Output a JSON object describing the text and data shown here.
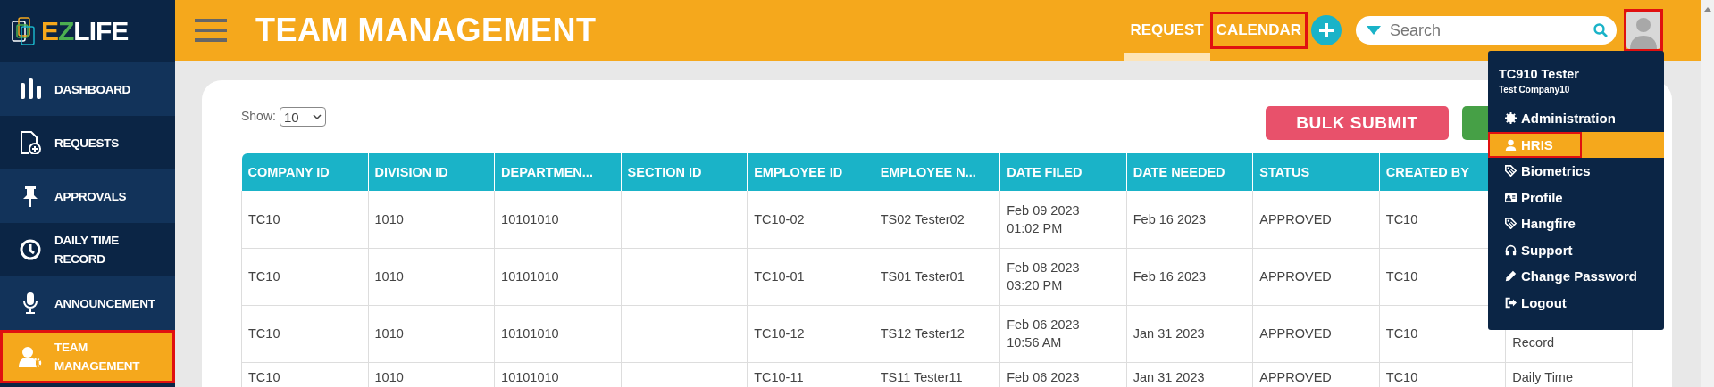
{
  "sidebar": {
    "logo": [
      {
        "text": "E",
        "color": "#f5a81c"
      },
      {
        "text": "Z",
        "color": "#4caf50"
      },
      {
        "text": "LIFE",
        "color": "#ffffff"
      }
    ],
    "items": [
      {
        "label": "DASHBOARD",
        "selected": false,
        "highlighted": false
      },
      {
        "label": "REQUESTS",
        "selected": false,
        "highlighted": false
      },
      {
        "label": "APPROVALS",
        "selected": false,
        "highlighted": false
      },
      {
        "label": "DAILY TIME RECORD",
        "selected": false,
        "highlighted": false
      },
      {
        "label": "ANNOUNCEMENT",
        "selected": false,
        "highlighted": false
      },
      {
        "label": "TEAM MANAGEMENT",
        "selected": true,
        "highlighted": true
      }
    ]
  },
  "header": {
    "title": "TEAM MANAGEMENT",
    "tabs": [
      {
        "label": "REQUEST",
        "selected": true,
        "highlighted": false
      },
      {
        "label": "CALENDAR",
        "selected": false,
        "highlighted": true
      }
    ],
    "search": {
      "placeholder": "Search"
    },
    "avatar": {
      "highlighted": true
    }
  },
  "toolbar": {
    "show_label": "Show:",
    "page_size": "10",
    "bulk_submit": "BULK SUBMIT"
  },
  "table": {
    "columns": [
      "COMPANY ID",
      "DIVISION ID",
      "DEPARTMEN...",
      "SECTION ID",
      "EMPLOYEE ID",
      "EMPLOYEE N...",
      "DATE FILED",
      "DATE NEEDED",
      "STATUS",
      "CREATED BY"
    ],
    "rows": [
      [
        "TC10",
        "1010",
        "10101010",
        "",
        "TC10-02",
        "TS02 Tester02",
        "Feb 09 2023\n01:02 PM",
        "Feb 16 2023",
        "APPROVED",
        "TC10",
        ""
      ],
      [
        "TC10",
        "1010",
        "10101010",
        "",
        "TC10-01",
        "TS01 Tester01",
        "Feb 08 2023\n03:20 PM",
        "Feb 16 2023",
        "APPROVED",
        "TC10",
        ""
      ],
      [
        "TC10",
        "1010",
        "10101010",
        "",
        "TC10-12",
        "TS12 Tester12",
        "Feb 06 2023\n10:56 AM",
        "Jan 31 2023",
        "APPROVED",
        "TC10",
        "Record"
      ],
      [
        "TC10",
        "1010",
        "10101010",
        "",
        "TC10-11",
        "TS11 Tester11",
        "Feb 06 2023",
        "Jan 31 2023",
        "APPROVED",
        "TC10",
        "Daily Time"
      ]
    ]
  },
  "user_menu": {
    "name": "TC910 Tester",
    "company": "Test Company10",
    "items": [
      {
        "label": "Administration",
        "selected": false,
        "highlighted": false
      },
      {
        "label": "HRIS",
        "selected": true,
        "highlighted": true
      },
      {
        "label": "Biometrics",
        "selected": false,
        "highlighted": false
      },
      {
        "label": "Profile",
        "selected": false,
        "highlighted": false
      },
      {
        "label": "Hangfire",
        "selected": false,
        "highlighted": false
      },
      {
        "label": "Support",
        "selected": false,
        "highlighted": false
      },
      {
        "label": "Change Password",
        "selected": false,
        "highlighted": false
      },
      {
        "label": "Logout",
        "selected": false,
        "highlighted": false
      }
    ]
  }
}
